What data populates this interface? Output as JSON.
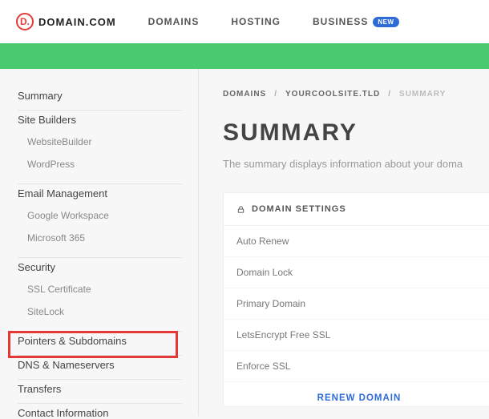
{
  "header": {
    "logo_text": "DOMAIN.COM",
    "nav": {
      "domains": "DOMAINS",
      "hosting": "HOSTING",
      "business": "BUSINESS",
      "business_badge": "NEW"
    }
  },
  "sidebar": {
    "summary": "Summary",
    "site_builders": {
      "label": "Site Builders",
      "websitebuilder": "WebsiteBuilder",
      "wordpress": "WordPress"
    },
    "email_mgmt": {
      "label": "Email Management",
      "google_workspace": "Google Workspace",
      "microsoft_365": "Microsoft 365"
    },
    "security": {
      "label": "Security",
      "ssl_certificate": "SSL Certificate",
      "sitelock": "SiteLock"
    },
    "pointers": "Pointers & Subdomains",
    "dns": "DNS & Nameservers",
    "transfers": "Transfers",
    "contact_info": "Contact Information"
  },
  "breadcrumb": {
    "domains": "DOMAINS",
    "site": "YOURCOOLSITE.TLD",
    "current": "SUMMARY",
    "sep": "/"
  },
  "main": {
    "title": "SUMMARY",
    "subtitle": "The summary displays information about your doma"
  },
  "panel": {
    "header": "DOMAIN SETTINGS",
    "rows": {
      "auto_renew": "Auto Renew",
      "domain_lock": "Domain Lock",
      "primary_domain": "Primary Domain",
      "letsencrypt": "LetsEncrypt Free SSL",
      "enforce_ssl": "Enforce SSL"
    },
    "action": "RENEW DOMAIN"
  }
}
